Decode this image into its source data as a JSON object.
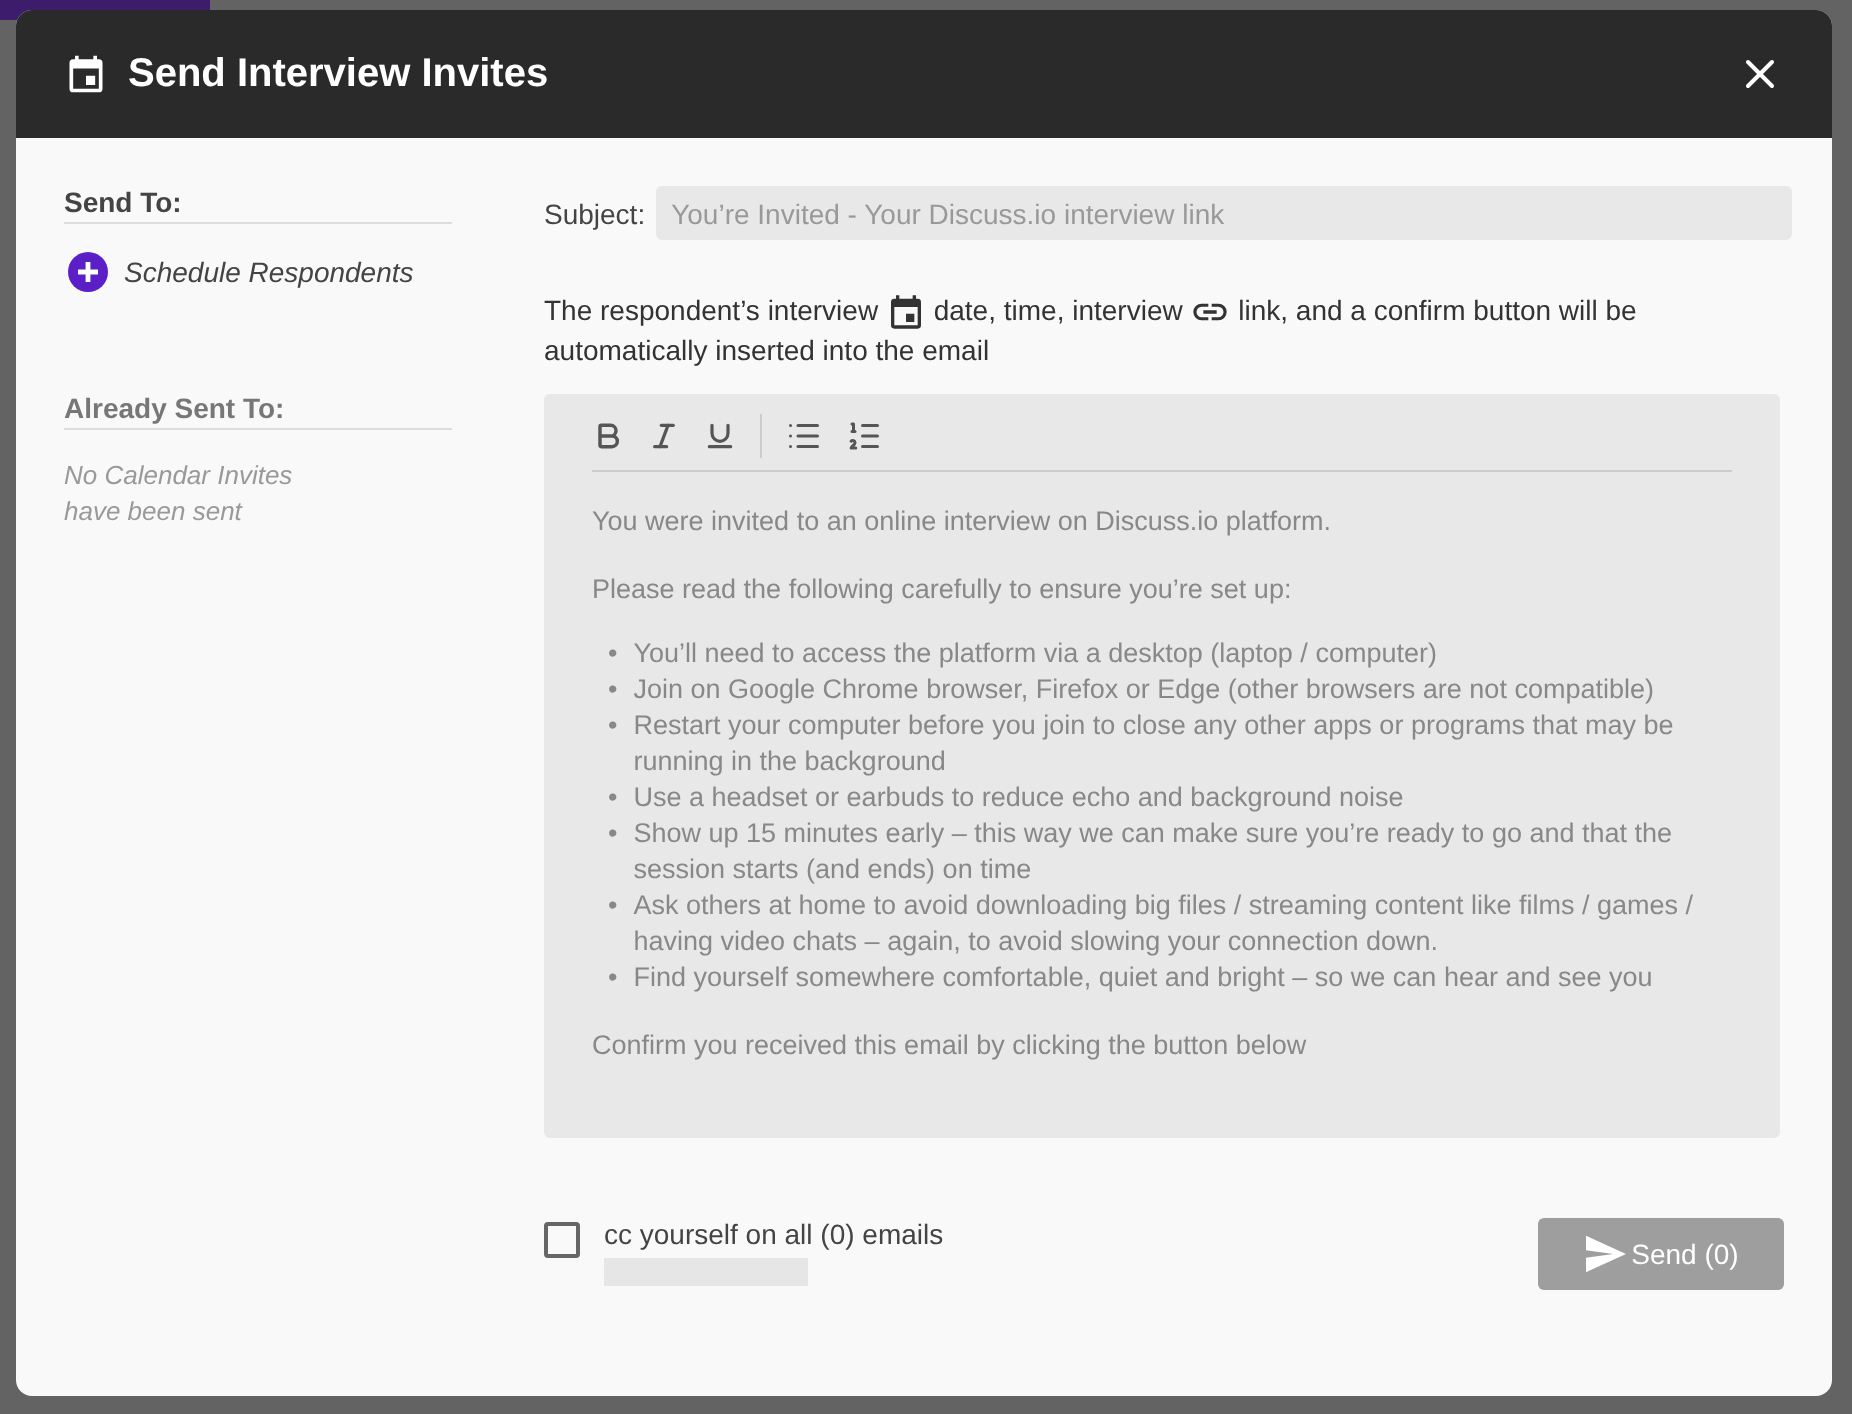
{
  "dialog": {
    "title": "Send Interview Invites"
  },
  "sidebar": {
    "send_to": {
      "heading": "Send To:",
      "action": "Schedule Respondents"
    },
    "already_sent": {
      "heading": "Already Sent To:",
      "empty": "No Calendar Invites have been sent"
    }
  },
  "subject": {
    "label": "Subject:",
    "placeholder": "You’re Invited - Your Discuss.io interview link"
  },
  "notice": [
    "The respondent’s interview",
    "date, time, interview",
    "link, and a confirm button will be automatically inserted into the email"
  ],
  "editor": {
    "body": [
      {
        "kind": "paragraph",
        "text": "You were invited to an online interview on Discuss.io platform."
      },
      {
        "kind": "paragraph",
        "text": "Please read the following carefully to ensure you’re set up:"
      },
      {
        "kind": "list",
        "marker": "•",
        "items": [
          "You’ll need to access the platform via a desktop (laptop / computer)",
          "Join on Google Chrome browser, Firefox or Edge (other browsers are not compatible)",
          "Restart your computer before you join to close any other apps or programs that may be running in the background",
          "Use a headset or earbuds to reduce echo and background noise",
          "Show up 15 minutes early – this way we can make sure you’re ready to go and that the session starts (and ends) on time",
          "Ask others at home to avoid downloading big files / streaming content like films / games / having video chats – again, to avoid slowing your connection down.",
          "Find yourself somewhere comfortable, quiet and bright – so we can hear and see you"
        ]
      },
      {
        "kind": "paragraph",
        "text": "Confirm you received this email by clicking the button below"
      }
    ]
  },
  "cc": {
    "label": "cc yourself on all (0) emails",
    "checked": false
  },
  "send": {
    "label": "Send (0)",
    "disabled": true
  }
}
